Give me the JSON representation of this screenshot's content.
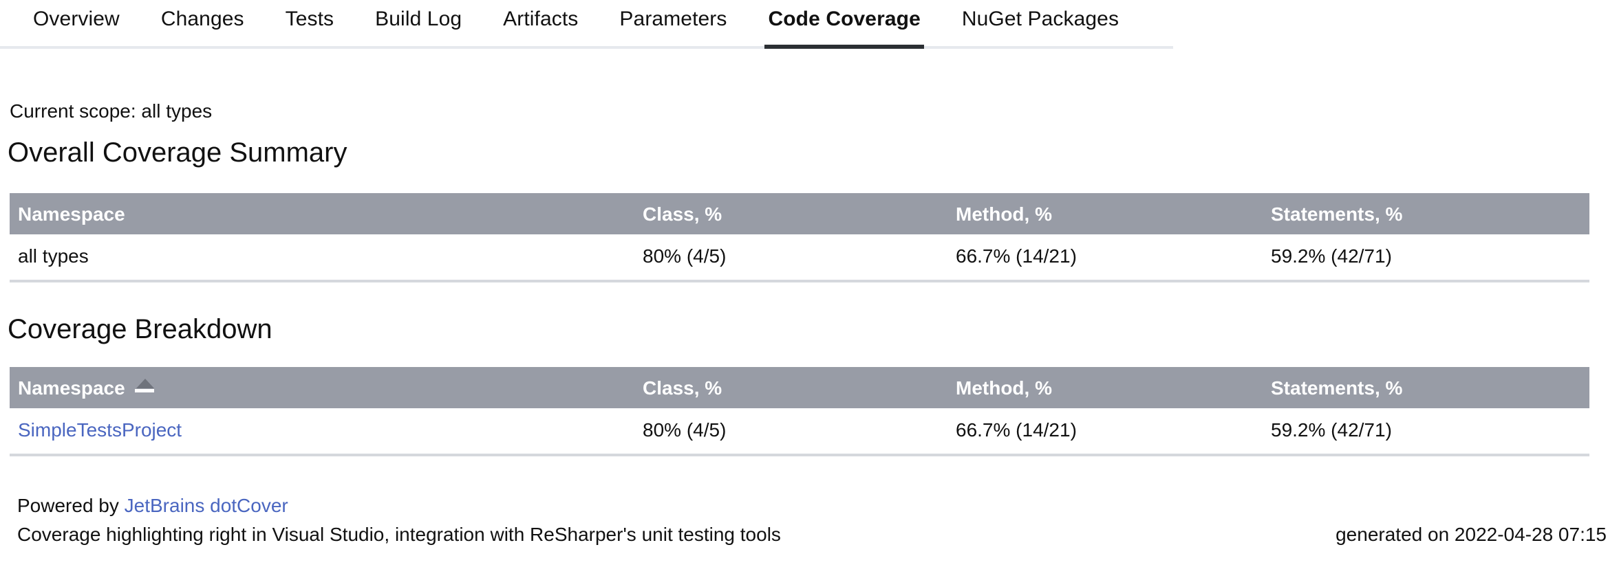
{
  "tabs": [
    {
      "label": "Overview",
      "active": false
    },
    {
      "label": "Changes",
      "active": false
    },
    {
      "label": "Tests",
      "active": false
    },
    {
      "label": "Build Log",
      "active": false
    },
    {
      "label": "Artifacts",
      "active": false
    },
    {
      "label": "Parameters",
      "active": false
    },
    {
      "label": "Code Coverage",
      "active": true
    },
    {
      "label": "NuGet Packages",
      "active": false
    }
  ],
  "scope": {
    "label": "Current scope: all types"
  },
  "overall": {
    "title": "Overall Coverage Summary",
    "columns": [
      "Namespace",
      "Class, %",
      "Method, %",
      "Statements, %"
    ],
    "rows": [
      {
        "namespace": "all types",
        "class": "80% (4/5)",
        "method": "66.7% (14/21)",
        "statements": "59.2% (42/71)"
      }
    ]
  },
  "breakdown": {
    "title": "Coverage Breakdown",
    "columns": [
      "Namespace",
      "Class, %",
      "Method, %",
      "Statements, %"
    ],
    "sort": {
      "column": "Namespace",
      "direction": "ascending",
      "icon": "sort-ascending-icon"
    },
    "rows": [
      {
        "namespace": "SimpleTestsProject",
        "class": "80% (4/5)",
        "method": "66.7% (14/21)",
        "statements": "59.2% (42/71)"
      }
    ]
  },
  "footer": {
    "powered_by_prefix": "Powered by ",
    "powered_by_link": "JetBrains dotCover",
    "tagline": "Coverage highlighting right in Visual Studio, integration with ReSharper's unit testing tools",
    "generated_on": "generated on 2022-04-28 07:15"
  },
  "colors": {
    "table_header_bg": "#989ca6",
    "table_header_text": "#ffffff",
    "row_border": "#d5d8dd",
    "link": "#4a66c0",
    "active_tab_underline": "#2b2f33",
    "tabbar_border": "#e6e9ee",
    "text": "#111111"
  }
}
